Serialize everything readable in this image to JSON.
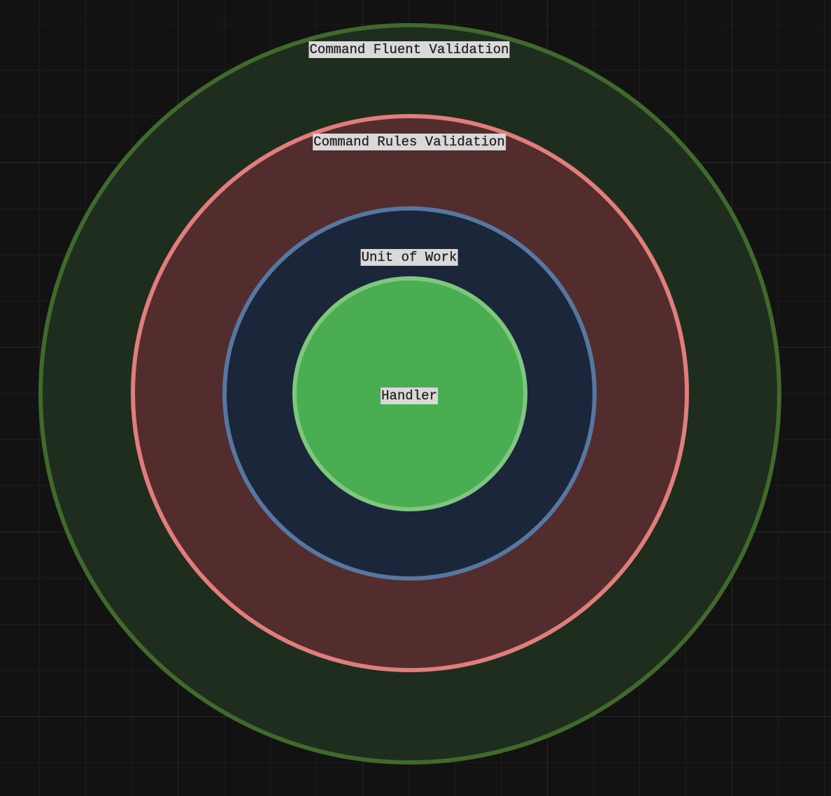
{
  "layers": [
    {
      "id": "outer",
      "label": "Command Fluent Validation",
      "fill": "#1f2d1e",
      "stroke": "#3f6a2c"
    },
    {
      "id": "second",
      "label": "Command Rules Validation",
      "fill": "#532d2e",
      "stroke": "#e07d7d"
    },
    {
      "id": "third",
      "label": "Unit of Work",
      "fill": "#1c263a",
      "stroke": "#56779f"
    },
    {
      "id": "inner",
      "label": "Handler",
      "fill": "#4aad52",
      "stroke": "#7fc77f"
    }
  ],
  "colors": {
    "background": "#121212",
    "grid_major": "#2a2a2a",
    "grid_minor": "#1d1d1d",
    "label_background": "#d9d9d9",
    "label_text": "#222222"
  }
}
